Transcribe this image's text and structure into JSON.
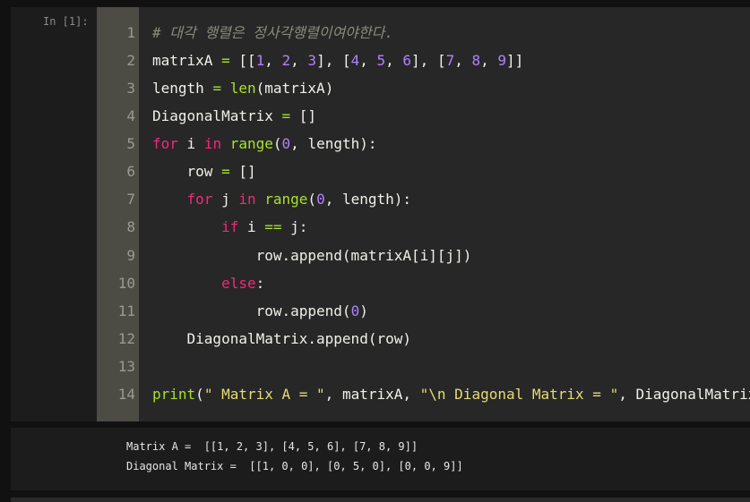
{
  "cell": {
    "prompt": "In [1]:",
    "line_numbers": [
      "1",
      "2",
      "3",
      "4",
      "5",
      "6",
      "7",
      "8",
      "9",
      "10",
      "11",
      "12",
      "13",
      "14"
    ],
    "code": {
      "l1": "# 대각 행렬은 정사각행렬이여야한다.",
      "l2": {
        "a": "matrixA ",
        "b": "=",
        "c": " [[",
        "d": "1",
        ",1": ", ",
        "e": "2",
        ",2": ", ",
        "f": "3",
        "g": "], [",
        "h": "4",
        ",3": ", ",
        "i": "5",
        ",4": ", ",
        "j": "6",
        "k": "], [",
        "l": "7",
        ",5": ", ",
        "m": "8",
        ",6": ", ",
        "n": "9",
        "o": "]]"
      },
      "l3": {
        "a": "length ",
        "b": "=",
        "c": " ",
        "d": "len",
        "e": "(matrixA)"
      },
      "l4": {
        "a": "DiagonalMatrix ",
        "b": "=",
        "c": " []"
      },
      "l5": {
        "a": "for",
        "b": " i ",
        "c": "in",
        "d": " ",
        "e": "range",
        "f": "(",
        "g": "0",
        "h": ", length):"
      },
      "l6": {
        "a": "    row ",
        "b": "=",
        "c": " []"
      },
      "l7": {
        "a": "    ",
        "b": "for",
        "c": " j ",
        "d": "in",
        "e": " ",
        "f": "range",
        "g": "(",
        "h": "0",
        "i": ", length):"
      },
      "l8": {
        "a": "        ",
        "b": "if",
        "c": " i ",
        "d": "==",
        "e": " j:"
      },
      "l9": {
        "a": "            row.append(matrixA[i][j])"
      },
      "l10": {
        "a": "        ",
        "b": "else",
        "c": ":"
      },
      "l11": {
        "a": "            row.append(",
        "b": "0",
        "c": ")"
      },
      "l12": {
        "a": "    DiagonalMatrix.append(row)"
      },
      "l13": {
        "a": ""
      },
      "l14": {
        "a": "print",
        "b": "(",
        "c": "\" Matrix A = \"",
        "d": ", matrixA, ",
        "e": "\"\\n Diagonal Matrix = \"",
        "f": ", DiagonalMatrix)"
      }
    }
  },
  "output": {
    "line1": "Matrix A =  [[1, 2, 3], [4, 5, 6], [7, 8, 9]]",
    "line2": "Diagonal Matrix =  [[1, 0, 0], [0, 5, 0], [0, 0, 9]]"
  }
}
